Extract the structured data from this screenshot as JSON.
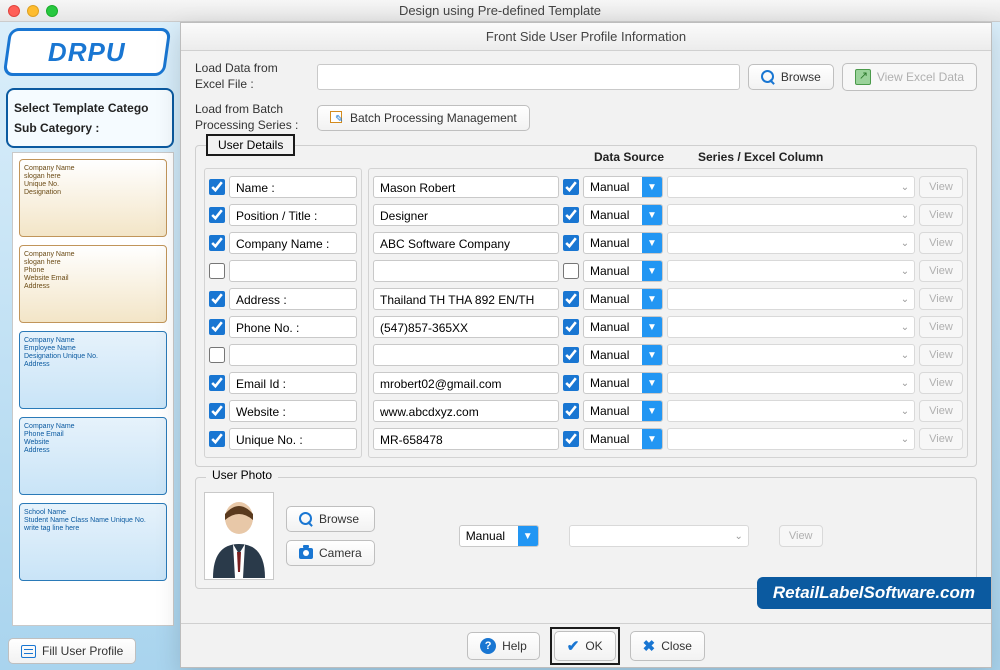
{
  "window": {
    "title": "Design using Pre-defined Template"
  },
  "logo": "DRPU",
  "bg_panel": {
    "line1": "Select Template Catego",
    "line2": "Sub Category :"
  },
  "bottom_button": "Fill User Profile",
  "templates": [
    {
      "l1": "Company Name",
      "l2": "slogan here",
      "l3": "Unique No.",
      "l4": "Designation",
      "style": "orange"
    },
    {
      "l1": "Company Name",
      "l2": "slogan here",
      "l3": "Phone",
      "l4": "Website  Email",
      "l5": "Address",
      "style": "orange"
    },
    {
      "l1": "Company Name",
      "l2": "Employee Name",
      "l3": "Designation  Unique No.",
      "l4": "Address",
      "style": "blue"
    },
    {
      "l1": "Company Name",
      "l2": "Phone  Email",
      "l3": "Website",
      "l4": "Address",
      "style": "blue"
    },
    {
      "l1": "School Name",
      "l2": "Student Name  Class Name  Unique No.",
      "l3": "write tag line here",
      "style": "blue"
    }
  ],
  "modal": {
    "title": "Front Side User Profile Information",
    "load_excel_label": "Load Data from Excel File :",
    "browse": "Browse",
    "view_excel": "View Excel Data",
    "load_batch_label": "Load from Batch Processing Series :",
    "batch_btn": "Batch Processing Management",
    "legend": "User Details",
    "head_ds": "Data Source",
    "head_series": "Series / Excel Column",
    "ds_option": "Manual",
    "view": "View",
    "rows": [
      {
        "chk": true,
        "label": "Name :",
        "val": "Mason Robert",
        "chk2": true
      },
      {
        "chk": true,
        "label": "Position / Title :",
        "val": "Designer",
        "chk2": true
      },
      {
        "chk": true,
        "label": "Company Name :",
        "val": "ABC Software Company",
        "chk2": true
      },
      {
        "chk": false,
        "label": "",
        "val": "",
        "chk2": false
      },
      {
        "chk": true,
        "label": "Address :",
        "val": "Thailand TH THA 892 EN/TH",
        "chk2": true
      },
      {
        "chk": true,
        "label": "Phone No. :",
        "val": "(547)857-365XX",
        "chk2": true
      },
      {
        "chk": false,
        "label": "",
        "val": "",
        "chk2": true
      },
      {
        "chk": true,
        "label": "Email Id :",
        "val": "mrobert02@gmail.com",
        "chk2": true
      },
      {
        "chk": true,
        "label": "Website :",
        "val": "www.abcdxyz.com",
        "chk2": true
      },
      {
        "chk": true,
        "label": "Unique No. :",
        "val": "MR-658478",
        "chk2": true
      }
    ],
    "photo_legend": "User Photo",
    "photo_browse": "Browse",
    "photo_camera": "Camera",
    "watermark": "RetailLabelSoftware.com",
    "help": "Help",
    "ok": "OK",
    "close": "Close"
  }
}
